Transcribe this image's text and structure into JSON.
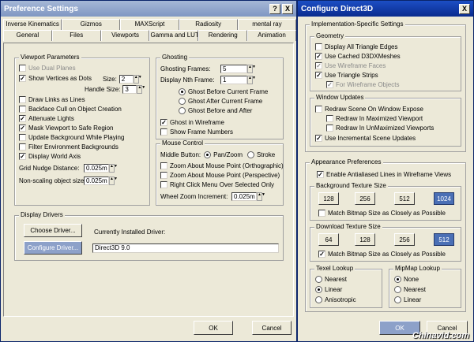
{
  "win1": {
    "title": "Preference Settings",
    "help_btn": "?",
    "close_btn": "X",
    "tabs_row1": [
      "Inverse Kinematics",
      "Gizmos",
      "MAXScript",
      "Radiosity",
      "mental ray"
    ],
    "tabs_row2": [
      "General",
      "Files",
      "Viewports",
      "Gamma and LUT",
      "Rendering",
      "Animation"
    ],
    "viewport_params": {
      "label": "Viewport Parameters",
      "use_dual_planes": "Use Dual Planes",
      "show_vertices": "Show Vertices as Dots",
      "size_label": "Size:",
      "size_value": "2",
      "handle_size_label": "Handle Size:",
      "handle_size_value": "3",
      "draw_links": "Draw Links as Lines",
      "backface_cull": "Backface Cull on Object Creation",
      "attenuate_lights": "Attenuate Lights",
      "mask_viewport": "Mask Viewport to Safe Region",
      "update_bg": "Update Background While Playing",
      "filter_env": "Filter Environment Backgrounds",
      "display_world_axis": "Display World Axis",
      "grid_nudge_label": "Grid Nudge Distance:",
      "grid_nudge_value": "0.025m",
      "nonscaling_label": "Non-scaling object size:",
      "nonscaling_value": "0.025m"
    },
    "ghosting": {
      "label": "Ghosting",
      "frames_label": "Ghosting Frames:",
      "frames_value": "5",
      "nth_label": "Display Nth Frame:",
      "nth_value": "1",
      "before": "Ghost Before Current Frame",
      "after": "Ghost After Current Frame",
      "before_after": "Ghost Before and After",
      "wireframe": "Ghost in Wireframe",
      "show_numbers": "Show Frame Numbers"
    },
    "mouse": {
      "label": "Mouse Control",
      "middle_label": "Middle Button:",
      "pan_zoom": "Pan/Zoom",
      "stroke": "Stroke",
      "zoom_ortho": "Zoom About Mouse Point (Orthographic)",
      "zoom_persp": "Zoom About Mouse Point (Perspective)",
      "right_click": "Right Click Menu Over Selected Only",
      "wheel_label": "Wheel Zoom Increment:",
      "wheel_value": "0.025m"
    },
    "drivers": {
      "label": "Display Drivers",
      "choose_btn": "Choose Driver...",
      "configure_btn": "Configure Driver...",
      "installed_label": "Currently Installed Driver:",
      "installed_value": "Direct3D 9.0"
    },
    "ok": "OK",
    "cancel": "Cancel"
  },
  "win2": {
    "title": "Configure Direct3D",
    "close_btn": "X",
    "impl_label": "Implementation-Specific Settings",
    "geometry": {
      "label": "Geometry",
      "all_triangle_edges": "Display All Triangle Edges",
      "cached_meshes": "Use Cached D3DXMeshes",
      "wireframe_faces": "Use Wireframe Faces",
      "triangle_strips": "Use Triangle Strips",
      "for_wireframe": "For Wireframe Objects"
    },
    "window_updates": {
      "label": "Window Updates",
      "redraw_expose": "Redraw Scene On Window Expose",
      "redraw_max": "Redraw In Maximized Viewport",
      "redraw_unmax": "Redraw In UnMaximized Viewports",
      "incremental": "Use Incremental Scene Updates"
    },
    "appearance": {
      "label": "Appearance Preferences",
      "antialias": "Enable Antialiased Lines in Wireframe Views",
      "bg_tex_label": "Background Texture Size",
      "bg_sizes": [
        "128",
        "256",
        "512",
        "1024"
      ],
      "bg_match": "Match Bitmap Size as Closely as Possible",
      "dl_tex_label": "Download Texture Size",
      "dl_sizes": [
        "64",
        "128",
        "256",
        "512"
      ],
      "dl_match": "Match Bitmap Size as Closely as Possible",
      "texel_label": "Texel Lookup",
      "texel": [
        "Nearest",
        "Linear",
        "Anisotropic"
      ],
      "mipmap_label": "MipMap Lookup",
      "mipmap": [
        "None",
        "Nearest",
        "Linear"
      ]
    },
    "ok": "OK",
    "cancel": "Cancel"
  },
  "watermark": "Chinavid.com"
}
